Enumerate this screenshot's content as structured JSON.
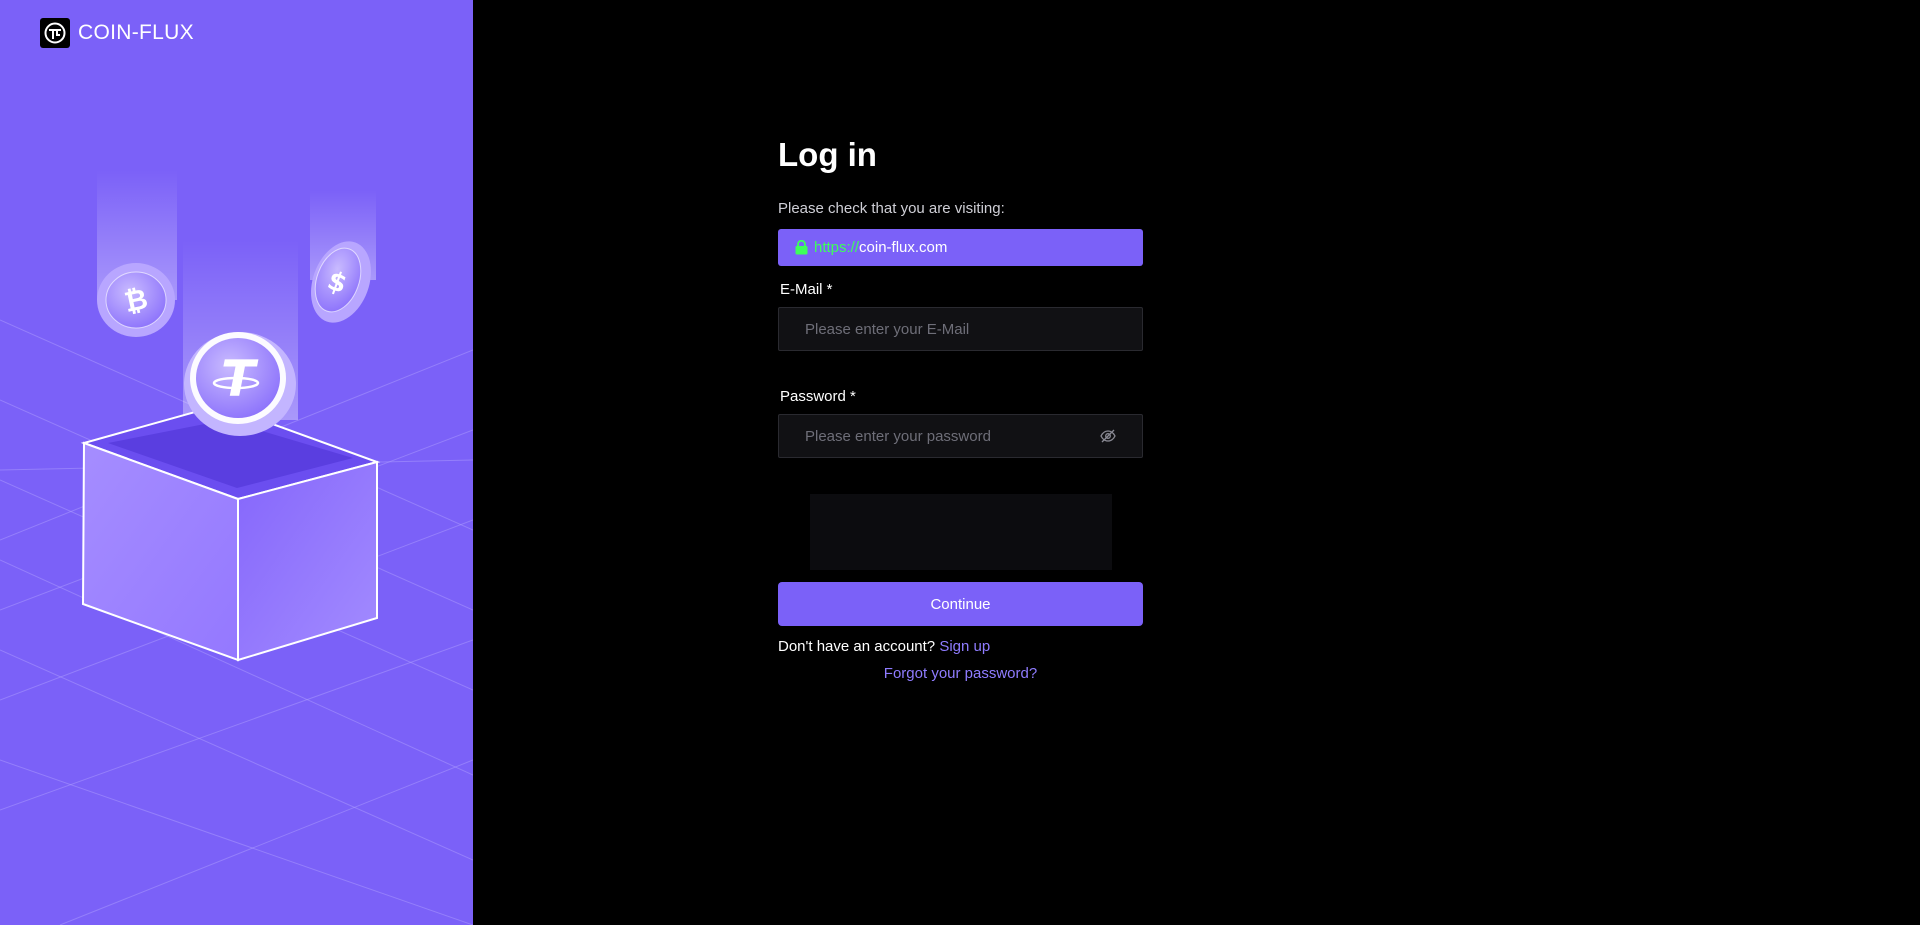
{
  "brand": {
    "name": "COIN-FLUX",
    "logo_icon": "coin-flux-logo-icon"
  },
  "login": {
    "title": "Log in",
    "check_text": "Please check that you are visiting:",
    "url": {
      "protocol": "https://",
      "host": "coin-flux.com",
      "icon": "lock-icon"
    },
    "email": {
      "label": "E-Mail *",
      "placeholder": "Please enter your E-Mail",
      "value": ""
    },
    "password": {
      "label": "Password *",
      "placeholder": "Please enter your password",
      "value": "",
      "toggle_icon": "eye-off-icon"
    },
    "continue_label": "Continue",
    "signup_prompt": "Don't have an account?",
    "signup_link": "Sign up",
    "forgot_link": "Forgot your password?"
  },
  "colors": {
    "accent": "#7b61f8",
    "secure_green": "#3dff5a",
    "link": "#8f7cff",
    "background": "#000000",
    "input_bg": "#111114"
  },
  "illustration": {
    "icons": [
      "bitcoin-coin-icon",
      "tether-coin-icon",
      "usdc-coin-icon",
      "open-box-icon"
    ]
  }
}
